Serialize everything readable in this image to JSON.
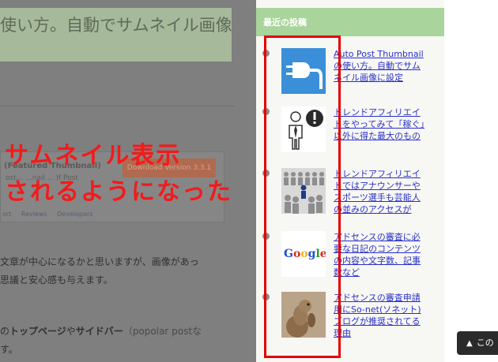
{
  "main": {
    "title": "使い方。自動でサムネイル画像",
    "plugin": {
      "name": "(Featured Thumbnail)",
      "meta": "ost... ...nail ... If Post",
      "download_label": "Download Version 3.3.1",
      "links": [
        "ort",
        "Reviews",
        "Developers"
      ]
    },
    "paragraph1": {
      "line1": "文章が中心になるかと思いますが、画像があっ",
      "line2": "思議と安心感も与えます。"
    },
    "paragraph2": {
      "pre": "の",
      "bold1": "トップページ",
      "mid": "や",
      "bold2": "サイドバー",
      "post": "（popolar postな",
      "line2": "す。"
    }
  },
  "annotation": {
    "line1": "サムネイル表示",
    "line2": "されるようになった"
  },
  "sidebar": {
    "widget_title": "最近の投稿",
    "posts": [
      {
        "title": "Auto Post Thumbnailの使い方。自動でサムネイル画像に設定",
        "thumb_icon": "plug-icon"
      },
      {
        "title": "トレンドアフィリエイトをやってみて「稼ぐ」以外に得た最大のもの",
        "thumb_icon": "businessman-icon"
      },
      {
        "title": "トレンドアフィリエイトではアナウンサーやスポーツ選手も芸能人の並みのアクセスが",
        "thumb_icon": "crowd-icon"
      },
      {
        "title": "アドセンスの審査に必要な日記のコンテンツの内容や文字数、記事数など",
        "thumb_icon": "google-logo"
      },
      {
        "title": "アドセンスの審査申請用にSo-net(ソネット)ブログが推奨されてる理由",
        "thumb_icon": "meerkat-photo"
      }
    ]
  },
  "back_to_top": {
    "label": "この"
  },
  "colors": {
    "annotation": "#f41a1a",
    "link": "#2a31c9",
    "widget_header": "#a9d49b"
  }
}
